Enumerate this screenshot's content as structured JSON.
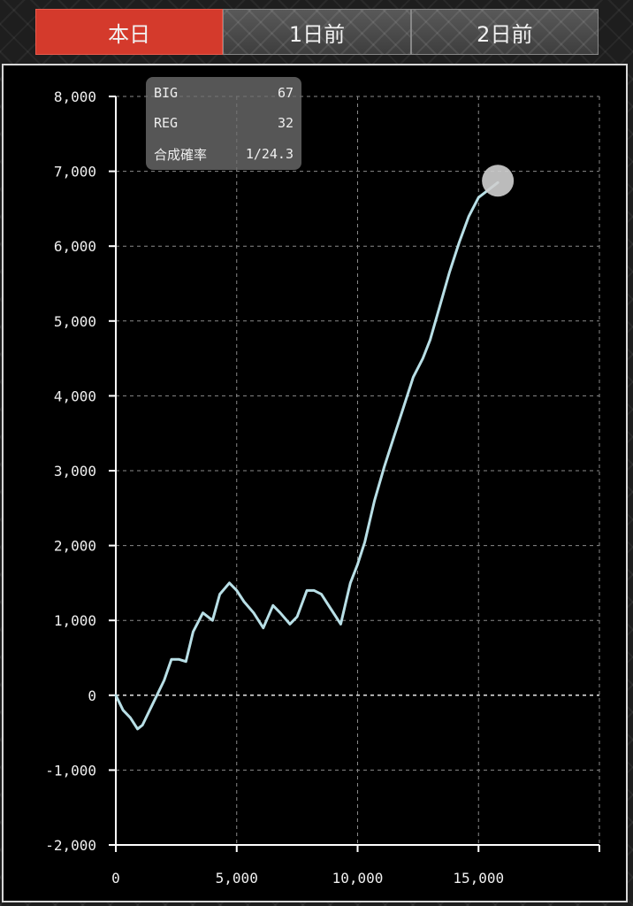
{
  "tabs": [
    {
      "label": "本日",
      "active": true
    },
    {
      "label": "1日前",
      "active": false
    },
    {
      "label": "2日前",
      "active": false
    }
  ],
  "stats": {
    "big_label": "BIG",
    "big_value": "67",
    "reg_label": "REG",
    "reg_value": "32",
    "prob_label": "合成確率",
    "prob_value": "1/24.3"
  },
  "colors": {
    "accent": "#d43a2c",
    "line": "#b8dfe6",
    "marker": "#cfcfcf"
  },
  "chart_data": {
    "type": "line",
    "title": "",
    "xlabel": "",
    "ylabel": "",
    "xlim": [
      0,
      20000
    ],
    "ylim": [
      -2000,
      8000
    ],
    "x_ticks": [
      0,
      5000,
      10000,
      15000
    ],
    "x_tick_labels": [
      "0",
      "5,000",
      "10,000",
      "15,000"
    ],
    "y_ticks": [
      8000,
      7000,
      6000,
      5000,
      4000,
      3000,
      2000,
      1000,
      0,
      -1000,
      -2000
    ],
    "y_tick_labels": [
      "8,000",
      "7,000",
      "6,000",
      "5,000",
      "4,000",
      "3,000",
      "2,000",
      "1,000",
      "0",
      "-1,000",
      "-2,000"
    ],
    "grid": true,
    "series": [
      {
        "x": [
          0,
          300,
          600,
          900,
          1100,
          1400,
          1700,
          2000,
          2300,
          2600,
          2900,
          3200,
          3600,
          4000,
          4300,
          4700,
          5000,
          5300,
          5700,
          6100,
          6500,
          6800,
          7200,
          7500,
          7900,
          8200,
          8500,
          8900,
          9300,
          9700,
          10000,
          10300,
          10700,
          11100,
          11500,
          11900,
          12300,
          12700,
          13000,
          13400,
          13800,
          14200,
          14600,
          15000,
          15400,
          15800
        ],
        "y": [
          0,
          -200,
          -300,
          -450,
          -400,
          -200,
          0,
          200,
          480,
          480,
          450,
          850,
          1100,
          1000,
          1350,
          1500,
          1400,
          1250,
          1100,
          900,
          1200,
          1100,
          950,
          1050,
          1400,
          1400,
          1350,
          1150,
          950,
          1500,
          1750,
          2050,
          2600,
          3050,
          3450,
          3850,
          4250,
          4500,
          4750,
          5200,
          5650,
          6050,
          6400,
          6650,
          6750,
          6850
        ]
      }
    ]
  }
}
